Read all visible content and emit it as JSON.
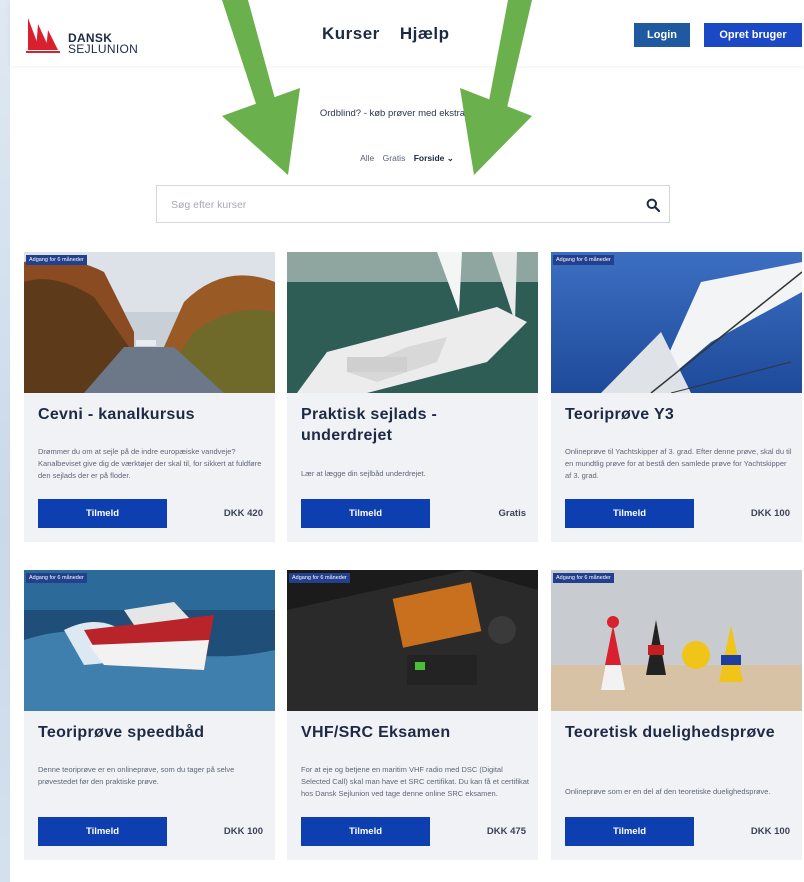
{
  "header": {
    "logo_line1": "DANSK",
    "logo_line2": "SEJLUNION",
    "nav": [
      "Kurser",
      "Hjælp"
    ],
    "login_label": "Login",
    "signup_label": "Opret bruger"
  },
  "promo": {
    "text": "Ordblind? - køb prøver med ekstra tid her"
  },
  "filters": {
    "items": [
      "Alle",
      "Gratis",
      "Forside ⌄"
    ],
    "active": "Forside ⌄"
  },
  "search": {
    "placeholder": "Søg efter kurser",
    "value": ""
  },
  "cards": [
    {
      "badge": "Adgang for 6 måneder",
      "title": "Cevni - kanalkursus",
      "description": "Drømmer du om at sejle på de indre europæiske vandveje? Kanalbeviset give dig de værktøjer der skal til, for sikkert at fuldføre den sejlads der er på floder.",
      "button": "Tilmeld",
      "price": "DKK 420"
    },
    {
      "badge": "",
      "title": "Praktisk sejlads - underdrejet",
      "description": "Lær at lægge din sejlbåd underdrejet.",
      "button": "Tilmeld",
      "price": "Gratis"
    },
    {
      "badge": "Adgang for 6 måneder",
      "title": "Teoriprøve Y3",
      "description": "Onlineprøve til Yachtskipper af 3. grad. Efter denne prøve, skal du til en mundtlig prøve for at bestå den samlede prøve for Yachtskipper af 3. grad.",
      "button": "Tilmeld",
      "price": "DKK 100"
    },
    {
      "badge": "Adgang for 6 måneder",
      "title": "Teoriprøve speedbåd",
      "description": "Denne teoriprøve er en onlineprøve, som du tager på selve prøvestedet før den praktiske prøve.",
      "button": "Tilmeld",
      "price": "DKK 100"
    },
    {
      "badge": "Adgang for 6 måneder",
      "title": "VHF/SRC Eksamen",
      "description": "For at eje og betjene en maritim VHF radio med DSC (Digital Selected Call) skal man have et SRC certifikat. Du kan få et certifikat hos Dansk Sejlunion ved tage denne online SRC eksamen.",
      "button": "Tilmeld",
      "price": "DKK 475"
    },
    {
      "badge": "Adgang for 6 måneder",
      "title": "Teoretisk duelighedsprøve",
      "description": "Onlineprøve som er en del af den teoretiske duelighedsprøve.",
      "button": "Tilmeld",
      "price": "DKK 100"
    }
  ],
  "colors": {
    "primary_button": "#0e3fb0",
    "login_button": "#1f5aa0",
    "title_text": "#1c2a44",
    "annotation_arrow": "#6ab04c"
  }
}
